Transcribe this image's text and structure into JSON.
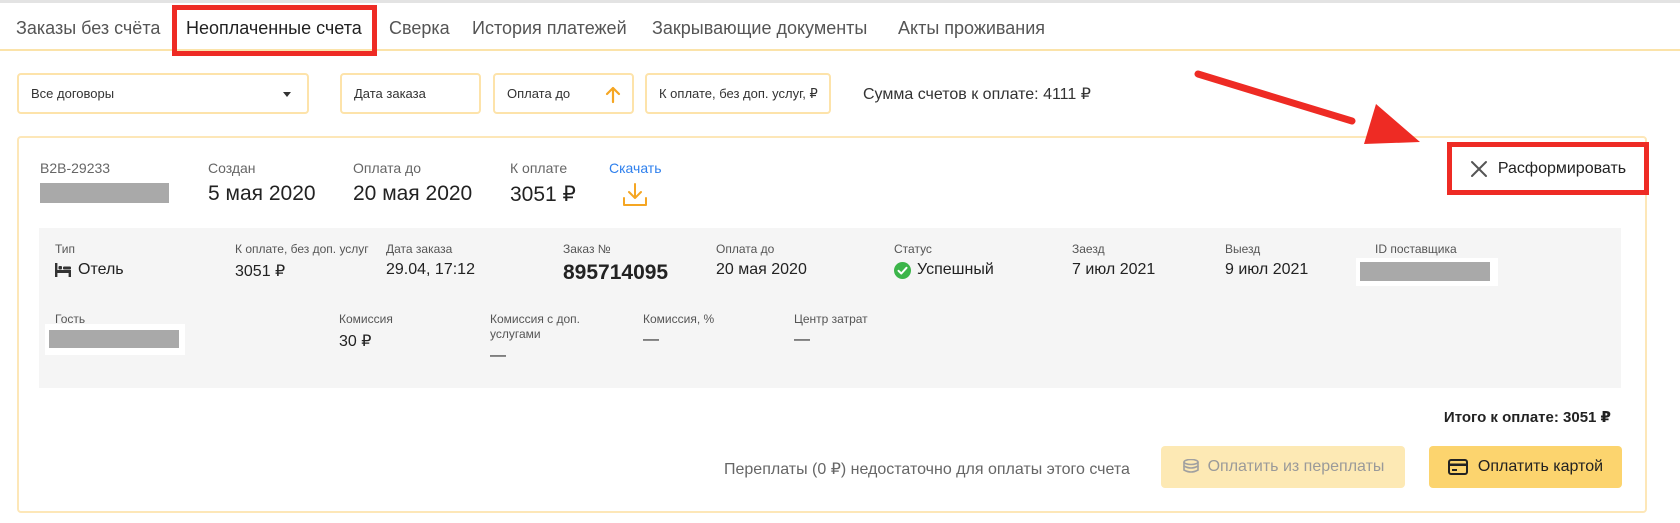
{
  "tabs": [
    {
      "label": "Заказы без счёта"
    },
    {
      "label": "Неоплаченные счета"
    },
    {
      "label": "Сверка"
    },
    {
      "label": "История платежей"
    },
    {
      "label": "Закрывающие документы"
    },
    {
      "label": "Акты проживания"
    }
  ],
  "filters": {
    "contracts": "Все договоры",
    "order_date": "Дата заказа",
    "pay_until": "Оплата до",
    "to_pay_no_extra": "К оплате, без доп. услуг, ₽"
  },
  "sum_label": "Сумма счетов к оплате: 4111 ₽",
  "invoice": {
    "number": "B2B-29233",
    "created_label": "Создан",
    "created_value": "5 мая 2020",
    "pay_until_label": "Оплата до",
    "pay_until_value": "20 мая 2020",
    "to_pay_label": "К оплате",
    "to_pay_value": "3051 ₽",
    "download_label": "Скачать",
    "disband_label": "Расформировать",
    "details": {
      "type_label": "Тип",
      "type_value": "Отель",
      "to_pay_no_extra_label": "К оплате, без доп. услуг",
      "to_pay_no_extra_value": "3051 ₽",
      "order_date_label": "Дата заказа",
      "order_date_value": "29.04, 17:12",
      "order_no_label": "Заказ №",
      "order_no_value": "895714095",
      "pay_until_label": "Оплата до",
      "pay_until_value": "20 мая 2020",
      "status_label": "Статус",
      "status_value": "Успешный",
      "checkin_label": "Заезд",
      "checkin_value": "7 июл 2021",
      "checkout_label": "Выезд",
      "checkout_value": "9 июл 2021",
      "supplier_id_label": "ID поставщика",
      "guest_label": "Гость",
      "commission_label": "Комиссия",
      "commission_value": "30 ₽",
      "commission_extra_label_1": "Комиссия с доп.",
      "commission_extra_label_2": "услугами",
      "commission_extra_value": "—",
      "commission_pct_label": "Комиссия, %",
      "commission_pct_value": "—",
      "cost_center_label": "Центр затрат",
      "cost_center_value": "—"
    },
    "total": "Итого к оплате: 3051 ₽",
    "overpay_note": "Переплаты (0 ₽) недостаточно для оплаты этого счета",
    "pay_from_overpay_label": "Оплатить из переплаты",
    "pay_by_card_label": "Оплатить картой"
  },
  "colors": {
    "accent": "#fcd46e",
    "highlight": "#ee2b24",
    "link": "#2f80ed",
    "success": "#3cb54a"
  }
}
